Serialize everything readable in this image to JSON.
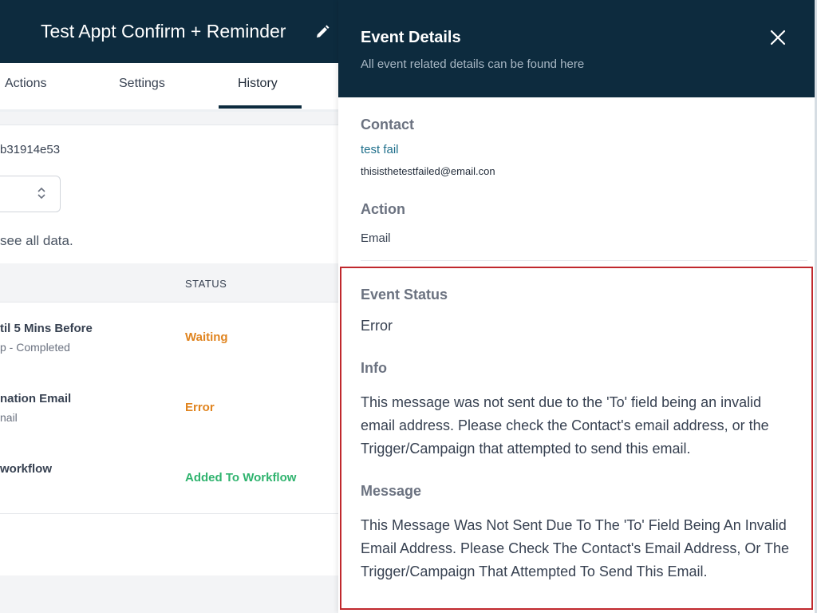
{
  "workflow": {
    "title": "Test Appt Confirm + Reminder",
    "tabs": [
      {
        "label": "Actions"
      },
      {
        "label": "Settings"
      },
      {
        "label": "History"
      }
    ],
    "id_text": "b31914e53",
    "hint": "see all data.",
    "table": {
      "status_header": "STATUS",
      "rows": [
        {
          "name": "til 5 Mins Before",
          "sub": "p - Completed",
          "status": "Waiting",
          "status_color": "#e0841f"
        },
        {
          "name": "nation Email",
          "sub": "nail",
          "status": "Error",
          "status_color": "#e0841f"
        },
        {
          "name": "workflow",
          "sub": "",
          "status": "Added To Workflow",
          "status_color": "#2fb36e"
        }
      ]
    }
  },
  "drawer": {
    "title": "Event Details",
    "subtitle": "All event related details can be found here",
    "contact_label": "Contact",
    "contact_name": "test fail",
    "contact_email": "thisisthetestfailed@email.con",
    "action_label": "Action",
    "action_value": "Email",
    "event_status_label": "Event Status",
    "event_status_value": "Error",
    "info_label": "Info",
    "info_text": "This message was not sent due to the 'To' field being an invalid email address. Please check the Contact's email address, or the Trigger/Campaign that attempted to send this email.",
    "message_label": "Message",
    "message_text": "This Message Was Not Sent Due To The 'To' Field Being An Invalid Email Address. Please Check The Contact's Email Address, Or The Trigger/Campaign That Attempted To Send This Email."
  },
  "icons": {
    "edit": "pencil-icon",
    "close": "close-icon",
    "select": "chevron-up-down-icon"
  },
  "colors": {
    "header_bg": "#0d2b3e",
    "highlight_border": "#c0282d",
    "link": "#1f6f8b"
  }
}
